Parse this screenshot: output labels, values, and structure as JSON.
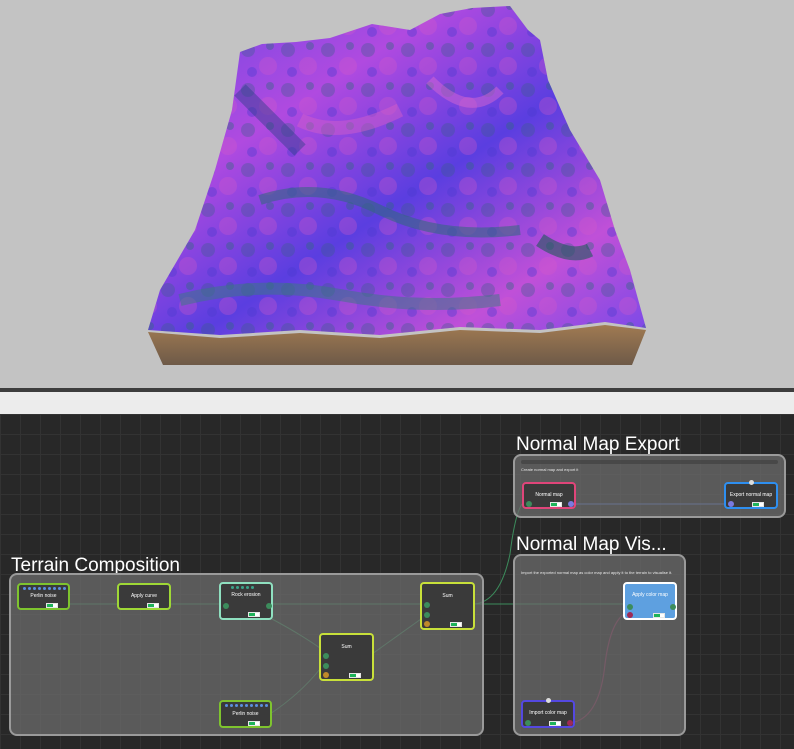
{
  "viewport": {
    "name": "terrain-3d-viewport"
  },
  "graph": {
    "groups": [
      {
        "id": "terrain",
        "title": "Terrain Composition",
        "description": ""
      },
      {
        "id": "export",
        "title": "Normal Map Export",
        "description": "Create normal map and export it"
      },
      {
        "id": "vis",
        "title": "Normal Map Vis...",
        "description": "Import the exported normal map as color map and apply it to the terrain to visualise it."
      }
    ],
    "nodes": {
      "perlin1": {
        "title": "Perlin noise"
      },
      "curve": {
        "title": "Apply curve"
      },
      "rock": {
        "title": "Rock erosion"
      },
      "sum_main": {
        "title": "Sum"
      },
      "sum_inner": {
        "title": "Sum"
      },
      "perlin2": {
        "title": "Perlin noise"
      },
      "normal_map": {
        "title": "Normal map"
      },
      "export_normal": {
        "title": "Export normal map"
      },
      "apply_color": {
        "title": "Apply color map"
      },
      "import_color": {
        "title": "Import color map"
      }
    }
  },
  "colors": {
    "generator_border": "#7ec42e",
    "filter_border": "#c8e03a",
    "erosion_border": "#8fe0c0",
    "normal_border": "#e0457a",
    "export_border": "#2e8ff0",
    "apply_color_border": "#ffffff",
    "import_border": "#5448e0",
    "wire_green": "#3c8c5c",
    "wire_blue": "#5a7be0",
    "wire_magenta": "#8a2a55"
  }
}
